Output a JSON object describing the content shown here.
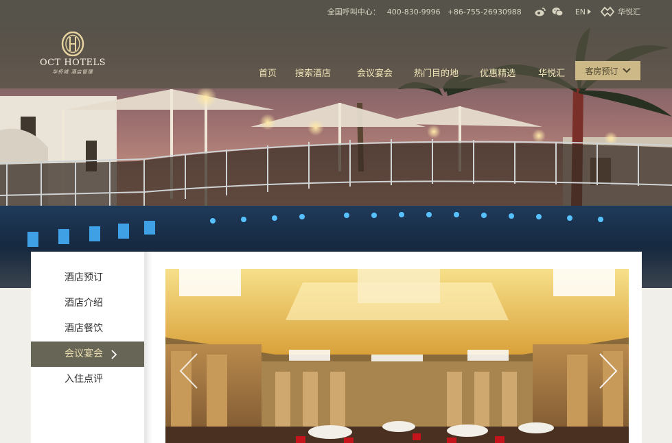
{
  "topbar": {
    "hotline_label": "全国呼叫中心：",
    "phone_1": "400-830-9996",
    "phone_2": "+86-755-26930988",
    "language": "EN",
    "club_label": "华悦汇"
  },
  "logo": {
    "brand": "OCT HOTELS",
    "sub": "华侨城 酒店管理"
  },
  "nav": {
    "items": [
      "首页",
      "搜索酒店",
      "会议宴会",
      "热门目的地",
      "优惠精选",
      "华悦汇"
    ],
    "book_label": "客房预订"
  },
  "sidebar": {
    "items": [
      {
        "label": "酒店预订"
      },
      {
        "label": "酒店介绍"
      },
      {
        "label": "酒店餐饮"
      },
      {
        "label": "会议宴会",
        "active": true
      },
      {
        "label": "入住点评"
      }
    ]
  },
  "colors": {
    "topbar": "#56544a",
    "gold": "#cdb887",
    "menu_text": "#f1e6b8",
    "active_bg": "#676656"
  }
}
